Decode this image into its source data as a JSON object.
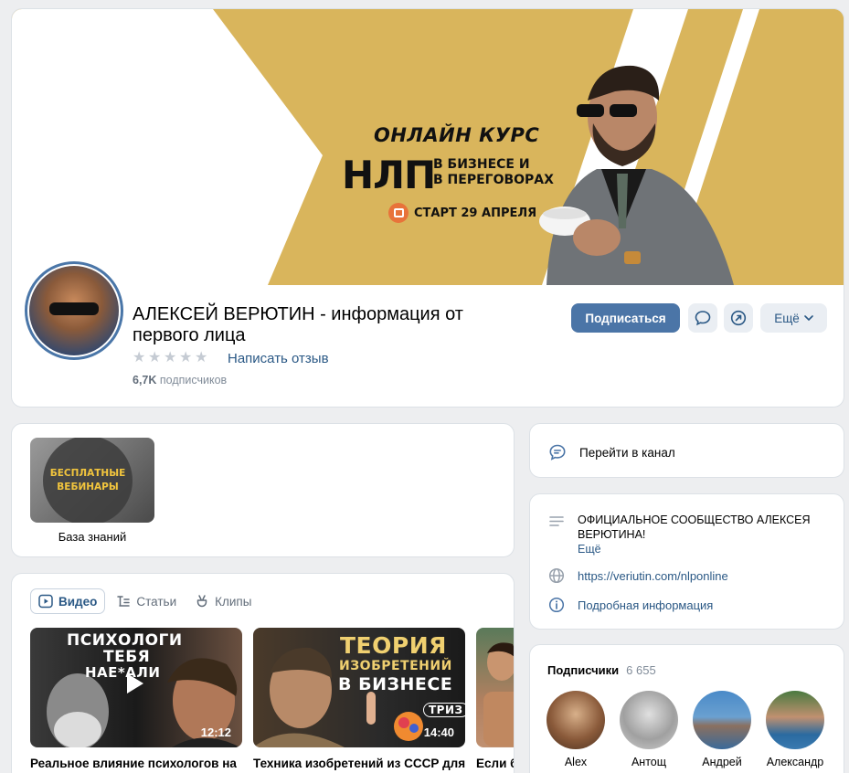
{
  "cover": {
    "line1": "ОНЛАЙН КУРС",
    "line2_big": "НЛП",
    "line2_sub1": "В БИЗНЕСЕ И",
    "line2_sub2": "В ПЕРЕГОВОРАХ",
    "start": "СТАРТ 29 АПРЕЛЯ"
  },
  "profile": {
    "name": "АЛЕКСЕЙ ВЕРЮТИН - информация от первого лица",
    "rating_stars": 5,
    "review_link": "Написать отзыв",
    "subscribers_bold": "6,7K",
    "subscribers_text": "подписчиков"
  },
  "actions": {
    "subscribe": "Подписаться",
    "more": "Ещё"
  },
  "knowledge": {
    "thumb_text_1": "БЕСПЛАТНЫЕ",
    "thumb_text_2": "ВЕБИНАРЫ",
    "label": "База знаний"
  },
  "tabs": [
    {
      "label": "Видео"
    },
    {
      "label": "Статьи"
    },
    {
      "label": "Клипы"
    }
  ],
  "videos": [
    {
      "thumb_text_1": "ПСИХОЛОГИ",
      "thumb_text_2": "ТЕБЯ",
      "thumb_text_3": "НАЕ*АЛИ",
      "duration": "12:12",
      "title": "Реальное влияние психологов на"
    },
    {
      "thumb_text_1": "ТЕОРИЯ",
      "thumb_text_2": "ИЗОБРЕТЕНИЙ",
      "thumb_text_3": "В БИЗНЕСЕ",
      "badge": "ТРИЗ",
      "duration": "14:40",
      "title": "Техника изобретений из СССР для"
    },
    {
      "title": "Если б"
    }
  ],
  "channel": {
    "label": "Перейти в канал"
  },
  "info": {
    "description": "ОФИЦИАЛЬНОЕ СООБЩЕСТВО АЛЕКСЕЯ ВЕРЮТИНА!",
    "more": "Ещё",
    "website": "https://veriutin.com/nlponline",
    "details": "Подробная информация"
  },
  "subscribers": {
    "title": "Подписчики",
    "count": "6 655",
    "people": [
      {
        "name": "Alex"
      },
      {
        "name": "Антощ"
      },
      {
        "name": "Андрей"
      },
      {
        "name": "Александр"
      }
    ]
  },
  "colors": {
    "accent": "#4b75a7",
    "link": "#2a5885",
    "cover_gold": "#d9b55c",
    "background": "#edeef0"
  }
}
